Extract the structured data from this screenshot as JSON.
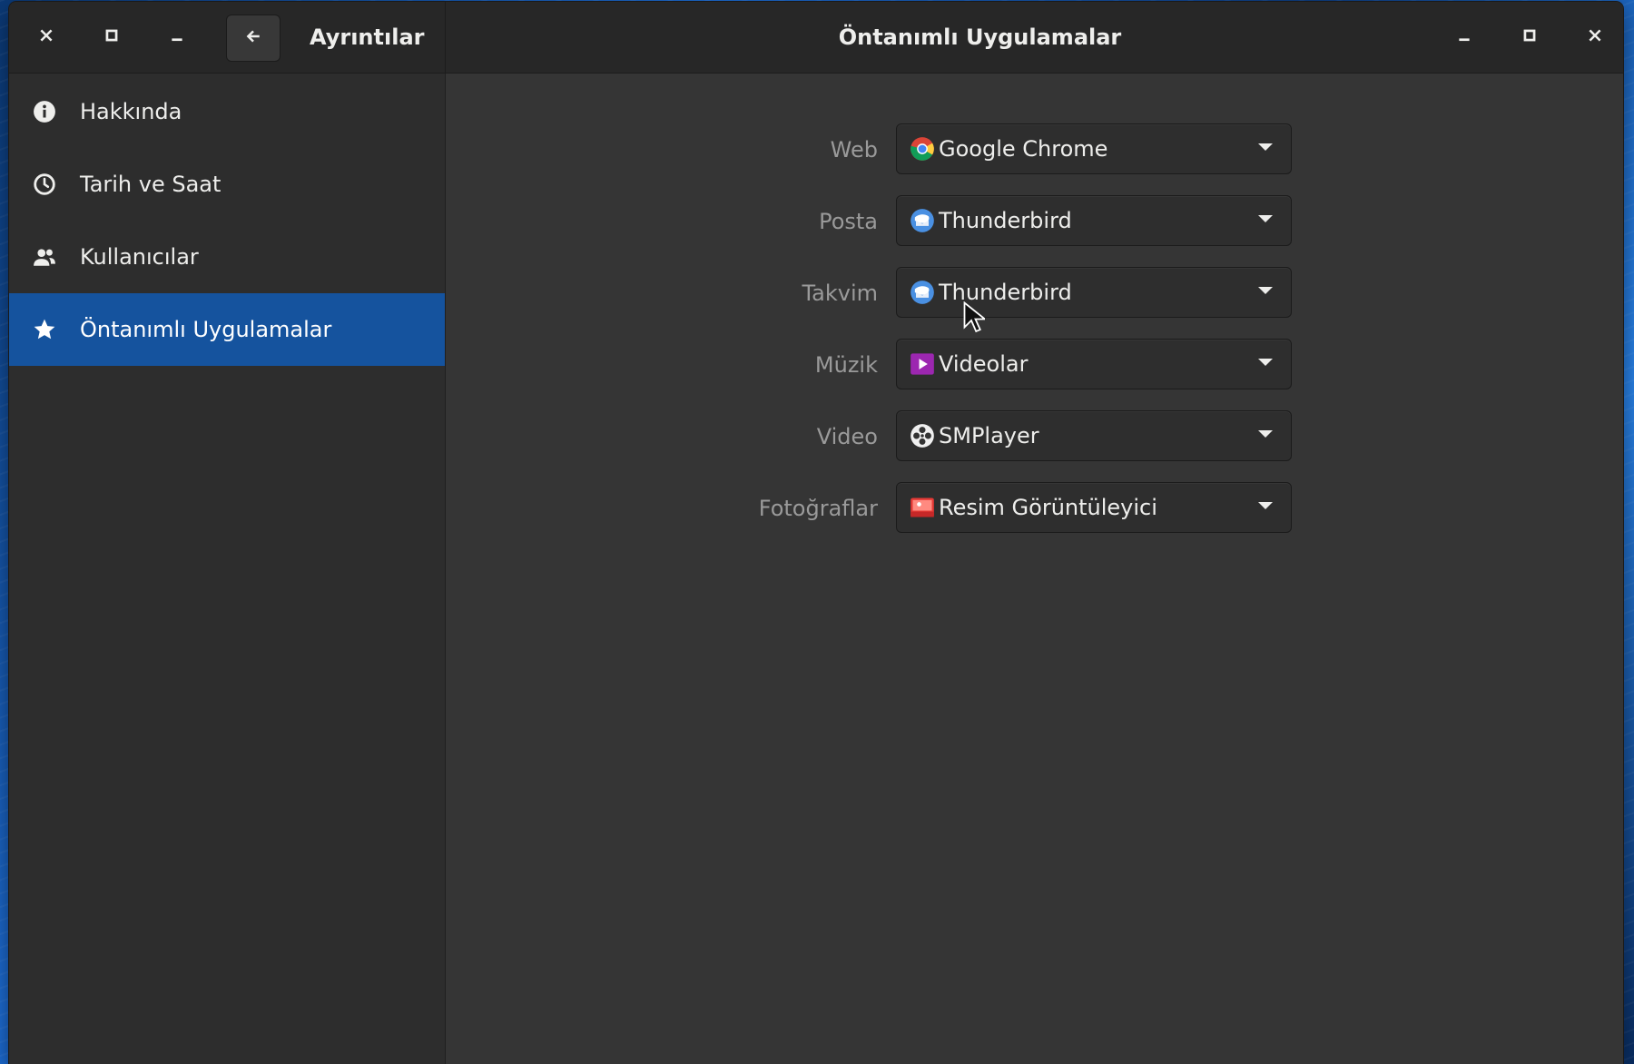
{
  "window": {
    "sidebar_title": "Ayrıntılar",
    "content_title": "Öntanımlı Uygulamalar"
  },
  "headerbar": {
    "left_controls": [
      "close-icon",
      "maximize-icon",
      "minimize-icon"
    ],
    "right_controls": [
      "minimize-icon",
      "maximize-icon",
      "close-icon"
    ],
    "back_icon": "arrow-left-icon"
  },
  "sidebar": {
    "selected_index": 3,
    "items": [
      {
        "label": "Hakkında",
        "icon": "info-icon"
      },
      {
        "label": "Tarih ve Saat",
        "icon": "clock-icon"
      },
      {
        "label": "Kullanıcılar",
        "icon": "users-icon"
      },
      {
        "label": "Öntanımlı Uygulamalar",
        "icon": "star-icon"
      }
    ]
  },
  "defaults": {
    "rows": [
      {
        "label": "Web",
        "value": "Google Chrome",
        "icon": "chrome-icon"
      },
      {
        "label": "Posta",
        "value": "Thunderbird",
        "icon": "thunderbird-icon"
      },
      {
        "label": "Takvim",
        "value": "Thunderbird",
        "icon": "thunderbird-icon"
      },
      {
        "label": "Müzik",
        "value": "Videolar",
        "icon": "videos-icon"
      },
      {
        "label": "Video",
        "value": "SMPlayer",
        "icon": "smplayer-icon"
      },
      {
        "label": "Fotoğraflar",
        "value": "Resim Görüntüleyici",
        "icon": "image-viewer-icon"
      }
    ]
  },
  "colors": {
    "accent": "#15539e",
    "window_bg": "#353535",
    "sidebar_bg": "#2d2d2d",
    "headerbar_bg": "#272727",
    "label_text": "#9a9a9a"
  }
}
